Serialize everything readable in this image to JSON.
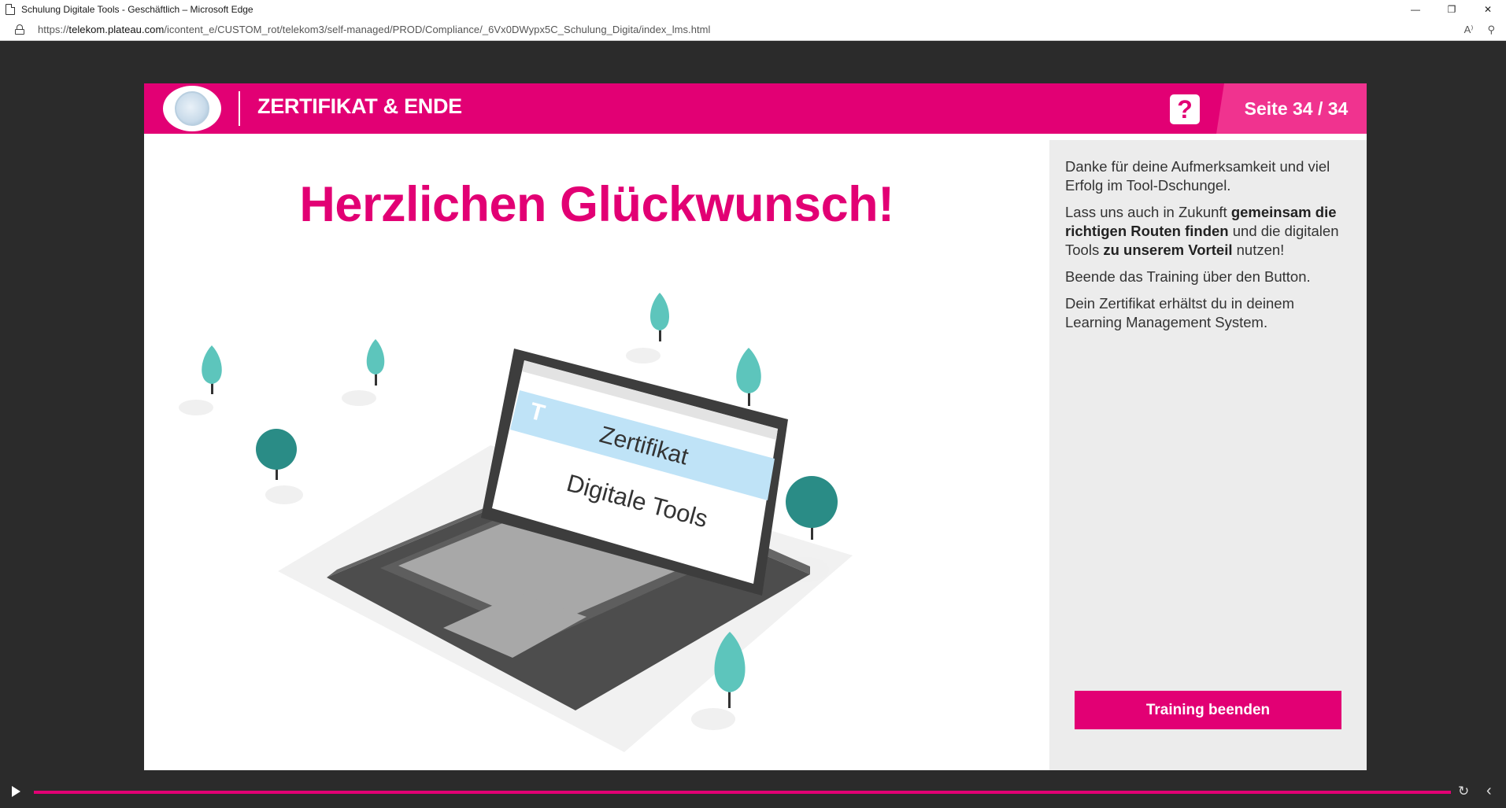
{
  "window": {
    "title": "Schulung Digitale Tools - Geschäftlich – Microsoft Edge",
    "minimize_glyph": "—",
    "restore_glyph": "❐",
    "close_glyph": "✕"
  },
  "address": {
    "prefix": "https://",
    "host": "telekom.plateau.com",
    "path": "/icontent_e/CUSTOM_rot/telekom3/self-managed/PROD/Compliance/_6Vx0DWypx5C_Schulung_Digita/index_lms.html",
    "read_aloud_glyph": "A⁾",
    "zoom_glyph": "⚲"
  },
  "header": {
    "title": "ZERTIFIKAT & ENDE",
    "help_glyph": "?",
    "page_label": "Seite 34 / 34"
  },
  "main": {
    "headline": "Herzlichen Glückwunsch!",
    "certificate_title": "Zertifikat",
    "certificate_subtitle": "Digitale Tools",
    "brand_glyph": "T"
  },
  "side_panel": {
    "p1": "Danke für deine Aufmerksamkeit und viel Erfolg im Tool-Dschungel.",
    "p2_a": "Lass uns auch in Zukunft ",
    "p2_b": "gemeinsam die richtigen Routen finden",
    "p2_c": " und die digitalen Tools ",
    "p2_d": "zu unserem Vorteil",
    "p2_e": " nutzen!",
    "p3": "Beende das Training über den Button.",
    "p4": "Dein Zertifikat erhältst du in deinem Learning Management System.",
    "button_label": "Training beenden"
  },
  "player": {
    "progress_percent": 100,
    "replay_glyph": "↻",
    "collapse_glyph": "‹"
  },
  "colors": {
    "magenta": "#e20074",
    "magenta_light": "#f0338f",
    "tree_teal": "#5dc5bc",
    "tree_dark": "#2a8c86"
  }
}
